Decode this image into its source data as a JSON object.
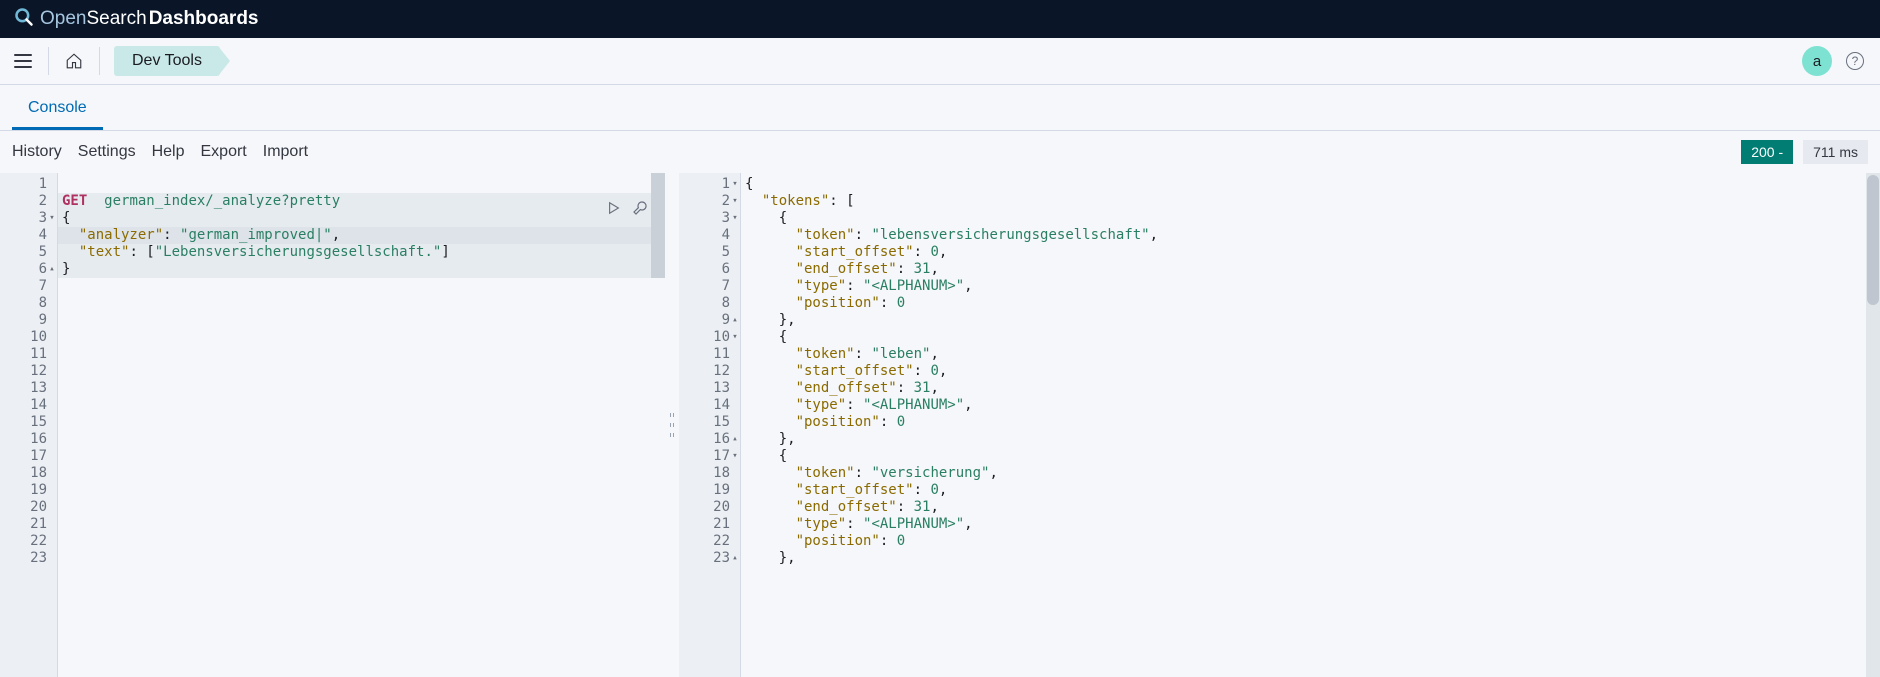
{
  "brand": {
    "open": "Open",
    "search": "Search",
    "dash": "Dashboards"
  },
  "breadcrumb": {
    "devtools": "Dev Tools"
  },
  "avatar": {
    "initial": "a"
  },
  "tabs": {
    "console": "Console"
  },
  "toolbar": {
    "history": "History",
    "settings": "Settings",
    "help": "Help",
    "export": "Export",
    "import": "Import"
  },
  "status": {
    "code": "200 -",
    "latency": "711 ms"
  },
  "request": {
    "method": "GET",
    "url": "german_index/_analyze?pretty",
    "lines": [
      {
        "n": 1,
        "text": ""
      },
      {
        "n": 2,
        "method": "GET",
        "url": "german_index/_analyze?pretty"
      },
      {
        "n": 3,
        "arrow": "▾",
        "raw": "{"
      },
      {
        "n": 4,
        "key": "\"analyzer\"",
        "sep": ": ",
        "val": "\"german_improved|\"",
        "tail": ","
      },
      {
        "n": 5,
        "key": "\"text\"",
        "sep": ": ",
        "raw_after": "[",
        "val": "\"Lebensversicherungsgesellschaft.\"",
        "tail": "]"
      },
      {
        "n": 6,
        "arrow": "▴",
        "raw": "}"
      },
      {
        "n": 7
      },
      {
        "n": 8
      },
      {
        "n": 9
      },
      {
        "n": 10
      },
      {
        "n": 11
      },
      {
        "n": 12
      },
      {
        "n": 13
      },
      {
        "n": 14
      },
      {
        "n": 15
      },
      {
        "n": 16
      },
      {
        "n": 17
      },
      {
        "n": 18
      },
      {
        "n": 19
      },
      {
        "n": 20
      },
      {
        "n": 21
      },
      {
        "n": 22
      },
      {
        "n": 23
      }
    ],
    "highlighted": [
      2,
      3,
      4,
      5,
      6
    ],
    "cursor_line": 4
  },
  "response": {
    "lines": [
      {
        "n": 1,
        "arrow": "▾",
        "segs": [
          {
            "t": "{",
            "c": "punc"
          }
        ]
      },
      {
        "n": 2,
        "arrow": "▾",
        "indent": 1,
        "segs": [
          {
            "t": "\"tokens\"",
            "c": "key"
          },
          {
            "t": ": [",
            "c": "punc"
          }
        ]
      },
      {
        "n": 3,
        "arrow": "▾",
        "indent": 2,
        "segs": [
          {
            "t": "{",
            "c": "punc"
          }
        ]
      },
      {
        "n": 4,
        "indent": 3,
        "segs": [
          {
            "t": "\"token\"",
            "c": "key"
          },
          {
            "t": ": ",
            "c": "punc"
          },
          {
            "t": "\"lebensversicherungsgesellschaft\"",
            "c": "str"
          },
          {
            "t": ",",
            "c": "punc"
          }
        ]
      },
      {
        "n": 5,
        "indent": 3,
        "segs": [
          {
            "t": "\"start_offset\"",
            "c": "key"
          },
          {
            "t": ": ",
            "c": "punc"
          },
          {
            "t": "0",
            "c": "num"
          },
          {
            "t": ",",
            "c": "punc"
          }
        ]
      },
      {
        "n": 6,
        "indent": 3,
        "segs": [
          {
            "t": "\"end_offset\"",
            "c": "key"
          },
          {
            "t": ": ",
            "c": "punc"
          },
          {
            "t": "31",
            "c": "num"
          },
          {
            "t": ",",
            "c": "punc"
          }
        ]
      },
      {
        "n": 7,
        "indent": 3,
        "segs": [
          {
            "t": "\"type\"",
            "c": "key"
          },
          {
            "t": ": ",
            "c": "punc"
          },
          {
            "t": "\"<ALPHANUM>\"",
            "c": "str"
          },
          {
            "t": ",",
            "c": "punc"
          }
        ]
      },
      {
        "n": 8,
        "indent": 3,
        "segs": [
          {
            "t": "\"position\"",
            "c": "key"
          },
          {
            "t": ": ",
            "c": "punc"
          },
          {
            "t": "0",
            "c": "num"
          }
        ]
      },
      {
        "n": 9,
        "arrow": "▴",
        "indent": 2,
        "segs": [
          {
            "t": "},",
            "c": "punc"
          }
        ]
      },
      {
        "n": 10,
        "arrow": "▾",
        "indent": 2,
        "segs": [
          {
            "t": "{",
            "c": "punc"
          }
        ]
      },
      {
        "n": 11,
        "indent": 3,
        "segs": [
          {
            "t": "\"token\"",
            "c": "key"
          },
          {
            "t": ": ",
            "c": "punc"
          },
          {
            "t": "\"leben\"",
            "c": "str"
          },
          {
            "t": ",",
            "c": "punc"
          }
        ]
      },
      {
        "n": 12,
        "indent": 3,
        "segs": [
          {
            "t": "\"start_offset\"",
            "c": "key"
          },
          {
            "t": ": ",
            "c": "punc"
          },
          {
            "t": "0",
            "c": "num"
          },
          {
            "t": ",",
            "c": "punc"
          }
        ]
      },
      {
        "n": 13,
        "indent": 3,
        "segs": [
          {
            "t": "\"end_offset\"",
            "c": "key"
          },
          {
            "t": ": ",
            "c": "punc"
          },
          {
            "t": "31",
            "c": "num"
          },
          {
            "t": ",",
            "c": "punc"
          }
        ]
      },
      {
        "n": 14,
        "indent": 3,
        "segs": [
          {
            "t": "\"type\"",
            "c": "key"
          },
          {
            "t": ": ",
            "c": "punc"
          },
          {
            "t": "\"<ALPHANUM>\"",
            "c": "str"
          },
          {
            "t": ",",
            "c": "punc"
          }
        ]
      },
      {
        "n": 15,
        "indent": 3,
        "segs": [
          {
            "t": "\"position\"",
            "c": "key"
          },
          {
            "t": ": ",
            "c": "punc"
          },
          {
            "t": "0",
            "c": "num"
          }
        ]
      },
      {
        "n": 16,
        "arrow": "▴",
        "indent": 2,
        "segs": [
          {
            "t": "},",
            "c": "punc"
          }
        ]
      },
      {
        "n": 17,
        "arrow": "▾",
        "indent": 2,
        "segs": [
          {
            "t": "{",
            "c": "punc"
          }
        ]
      },
      {
        "n": 18,
        "indent": 3,
        "segs": [
          {
            "t": "\"token\"",
            "c": "key"
          },
          {
            "t": ": ",
            "c": "punc"
          },
          {
            "t": "\"versicherung\"",
            "c": "str"
          },
          {
            "t": ",",
            "c": "punc"
          }
        ]
      },
      {
        "n": 19,
        "indent": 3,
        "segs": [
          {
            "t": "\"start_offset\"",
            "c": "key"
          },
          {
            "t": ": ",
            "c": "punc"
          },
          {
            "t": "0",
            "c": "num"
          },
          {
            "t": ",",
            "c": "punc"
          }
        ]
      },
      {
        "n": 20,
        "indent": 3,
        "segs": [
          {
            "t": "\"end_offset\"",
            "c": "key"
          },
          {
            "t": ": ",
            "c": "punc"
          },
          {
            "t": "31",
            "c": "num"
          },
          {
            "t": ",",
            "c": "punc"
          }
        ]
      },
      {
        "n": 21,
        "indent": 3,
        "segs": [
          {
            "t": "\"type\"",
            "c": "key"
          },
          {
            "t": ": ",
            "c": "punc"
          },
          {
            "t": "\"<ALPHANUM>\"",
            "c": "str"
          },
          {
            "t": ",",
            "c": "punc"
          }
        ]
      },
      {
        "n": 22,
        "indent": 3,
        "segs": [
          {
            "t": "\"position\"",
            "c": "key"
          },
          {
            "t": ": ",
            "c": "punc"
          },
          {
            "t": "0",
            "c": "num"
          }
        ]
      },
      {
        "n": 23,
        "arrow": "▴",
        "indent": 2,
        "segs": [
          {
            "t": "},",
            "c": "punc"
          }
        ]
      }
    ]
  }
}
